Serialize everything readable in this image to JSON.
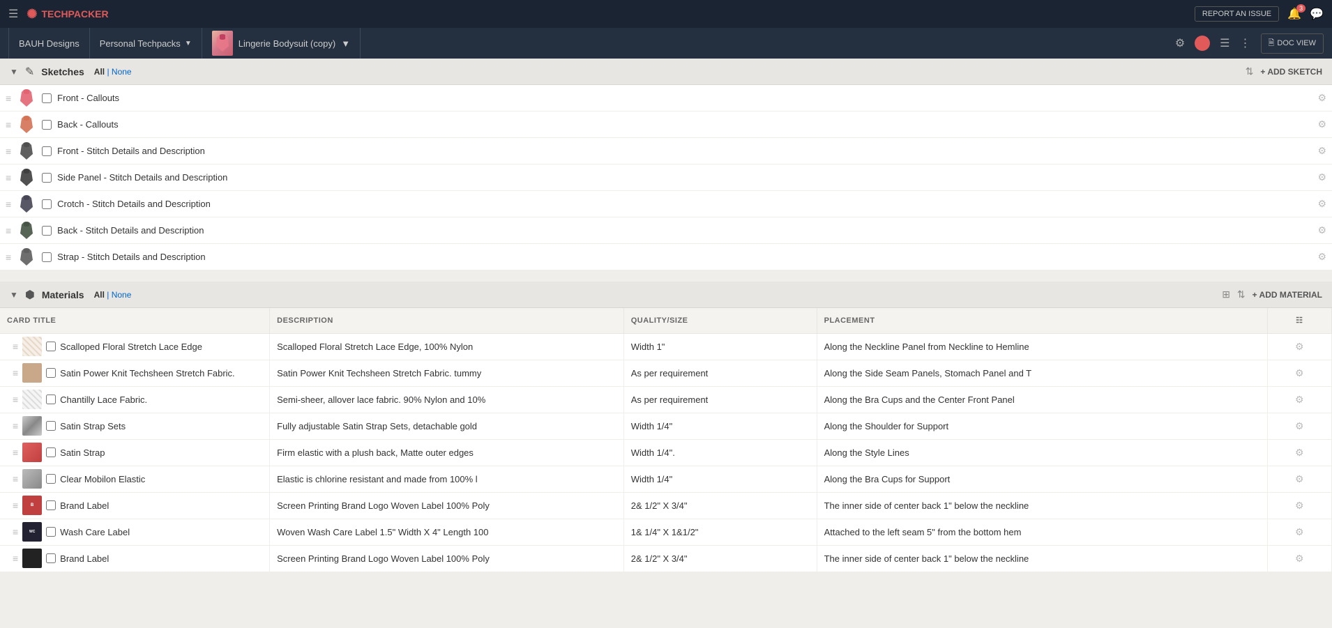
{
  "app": {
    "brand": "TECHPACKER",
    "report_issue": "REPORT AN ISSUE",
    "notifications_count": "3",
    "doc_view": "DOC VIEW"
  },
  "nav": {
    "workspace": "BAUH Designs",
    "techpacks": "Personal Techpacks",
    "product": "Lingerie Bodysuit (copy)"
  },
  "sketches_section": {
    "title": "Sketches",
    "filter_all": "All",
    "filter_none": "None",
    "add_label": "+ ADD SKETCH",
    "items": [
      {
        "id": 1,
        "name": "Front - Callouts",
        "thumb_type": "front-red"
      },
      {
        "id": 2,
        "name": "Back - Callouts",
        "thumb_type": "back-orange"
      },
      {
        "id": 3,
        "name": "Front - Stitch Details and Description",
        "thumb_type": "front-dark"
      },
      {
        "id": 4,
        "name": "Side Panel - Stitch Details and Description",
        "thumb_type": "side-dark"
      },
      {
        "id": 5,
        "name": "Crotch - Stitch Details and Description",
        "thumb_type": "crotch-dark"
      },
      {
        "id": 6,
        "name": "Back - Stitch Details and Description",
        "thumb_type": "back-dark"
      },
      {
        "id": 7,
        "name": "Strap - Stitch Details and Description",
        "thumb_type": "strap-dark"
      }
    ]
  },
  "materials_section": {
    "title": "Materials",
    "filter_all": "All",
    "filter_none": "None",
    "add_label": "+ ADD MATERIAL",
    "columns": {
      "card_title": "Card Title",
      "description": "DESCRIPTION",
      "quality_size": "QUALITY/SIZE",
      "placement": "PLACEMENT"
    },
    "items": [
      {
        "id": 1,
        "name": "Scalloped Floral Stretch Lace Edge",
        "description": "Scalloped Floral Stretch Lace Edge, 100% Nylon",
        "quality": "Width 1\"",
        "placement": "Along the Neckline Panel from Neckline to Hemline",
        "thumb_type": "lace"
      },
      {
        "id": 2,
        "name": "Satin Power Knit Techsheen Stretch Fabric.",
        "description": "Satin Power Knit Techsheen Stretch Fabric. tummy",
        "quality": "As per requirement",
        "placement": "Along the Side Seam Panels, Stomach Panel and T",
        "thumb_type": "fabric-tan"
      },
      {
        "id": 3,
        "name": "Chantilly Lace Fabric.",
        "description": "Semi-sheer, allover lace fabric. 90% Nylon and 10%",
        "quality": "As per requirement",
        "placement": "Along the Bra Cups and the Center Front Panel",
        "thumb_type": "lace-white"
      },
      {
        "id": 4,
        "name": "Satin Strap Sets",
        "description": "Fully adjustable Satin Strap Sets, detachable gold",
        "quality": "Width 1/4\"",
        "placement": "Along the Shoulder for Support",
        "thumb_type": "satin-gray"
      },
      {
        "id": 5,
        "name": "Satin Strap",
        "description": "Firm elastic with a plush back, Matte outer edges",
        "quality": "Width 1/4\".",
        "placement": "Along the Style Lines",
        "thumb_type": "satin-red"
      },
      {
        "id": 6,
        "name": "Clear Mobilon Elastic",
        "description": "Elastic is chlorine resistant and made from 100% l",
        "quality": "Width 1/4\"",
        "placement": "Along the Bra Cups for Support",
        "thumb_type": "elastic-gray"
      },
      {
        "id": 7,
        "name": "Brand Label",
        "description": "Screen Printing Brand Logo Woven Label 100% Poly",
        "quality": "2& 1/2\"  X 3/4\"",
        "placement": "The inner side of center back 1\" below the neckline",
        "thumb_type": "label-red"
      },
      {
        "id": 8,
        "name": "Wash Care Label",
        "description": "Woven Wash Care Label 1.5\" Width X 4\" Length 100",
        "quality": "1& 1/4\" X 1&1/2\"",
        "placement": "Attached to the left seam 5\" from the bottom hem",
        "thumb_type": "label-dark"
      },
      {
        "id": 9,
        "name": "Brand Label",
        "description": "Screen Printing Brand Logo Woven Label 100% Poly",
        "quality": "2& 1/2\"  X 3/4\"",
        "placement": "The inner side of center back 1\" below the neckline",
        "thumb_type": "black-strap"
      }
    ]
  }
}
